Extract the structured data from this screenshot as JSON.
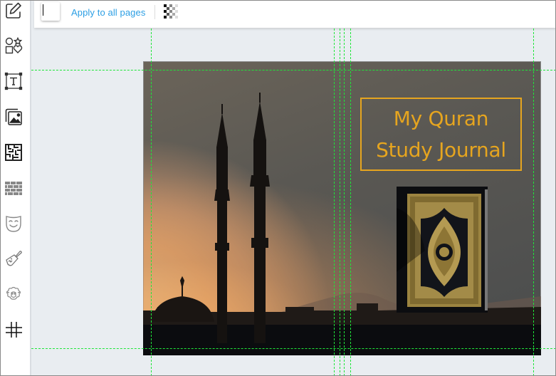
{
  "sidebar": {
    "tools": [
      {
        "name": "edit-tool",
        "icon": "pencil-square-icon"
      },
      {
        "name": "shapes-tool",
        "icon": "shapes-icon"
      },
      {
        "name": "text-tool",
        "icon": "text-box-icon"
      },
      {
        "name": "images-tool",
        "icon": "images-icon"
      },
      {
        "name": "puzzles-tool",
        "icon": "maze-icon"
      },
      {
        "name": "patterns-tool",
        "icon": "bricks-icon"
      },
      {
        "name": "masks-tool",
        "icon": "theater-mask-icon"
      },
      {
        "name": "paint-tool",
        "icon": "paint-brush-icon"
      },
      {
        "name": "animals-tool",
        "icon": "sheep-icon"
      },
      {
        "name": "grid-tool",
        "icon": "grid-hash-icon"
      }
    ]
  },
  "toolbar": {
    "background_color": "#ffffff",
    "apply_all_label": "Apply to all pages",
    "transparency_icon": "checkerboard-icon"
  },
  "cover": {
    "title_line1": "My Quran",
    "title_line2": "Study Journal",
    "title_color": "#e6a51f",
    "background_image": "mosque-silhouette-at-sunset",
    "foreground_image": "quran-book-gold-ornament"
  },
  "guides": {
    "color": "#1fe63a"
  }
}
